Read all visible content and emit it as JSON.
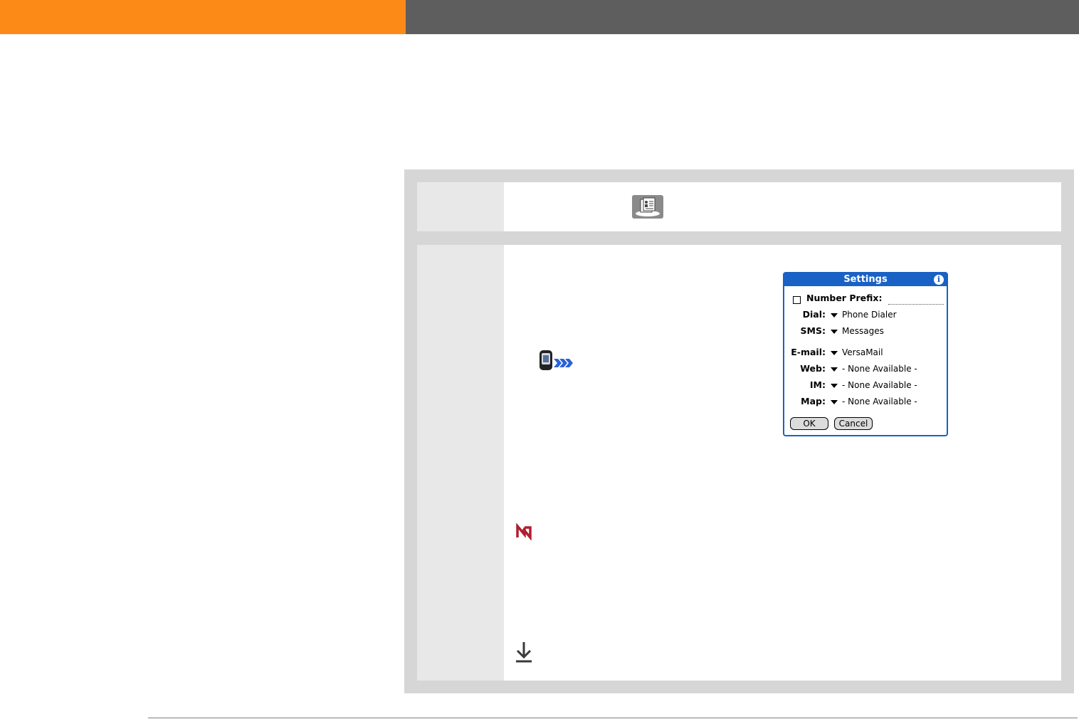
{
  "dialog": {
    "title": "Settings",
    "info_glyph": "i",
    "prefix_label": "Number Prefix:",
    "rows": [
      {
        "label": "Dial:",
        "value": "Phone Dialer"
      },
      {
        "label": "SMS:",
        "value": "Messages"
      },
      {
        "label": "E-mail:",
        "value": "VersaMail"
      },
      {
        "label": "Web:",
        "value": "- None Available -"
      },
      {
        "label": "IM:",
        "value": "- None Available -"
      },
      {
        "label": "Map:",
        "value": "- None Available -"
      }
    ],
    "ok_label": "OK",
    "cancel_label": "Cancel"
  },
  "colors": {
    "header_orange": "#fc8a17",
    "header_gray": "#5e5e5e",
    "dialog_blue": "#1a61c5",
    "tip_red": "#b01e2e"
  },
  "icons": [
    "contacts-icon",
    "handheld-icon",
    "tip-icon",
    "down-arrow-icon",
    "info-icon",
    "checkbox-icon"
  ]
}
